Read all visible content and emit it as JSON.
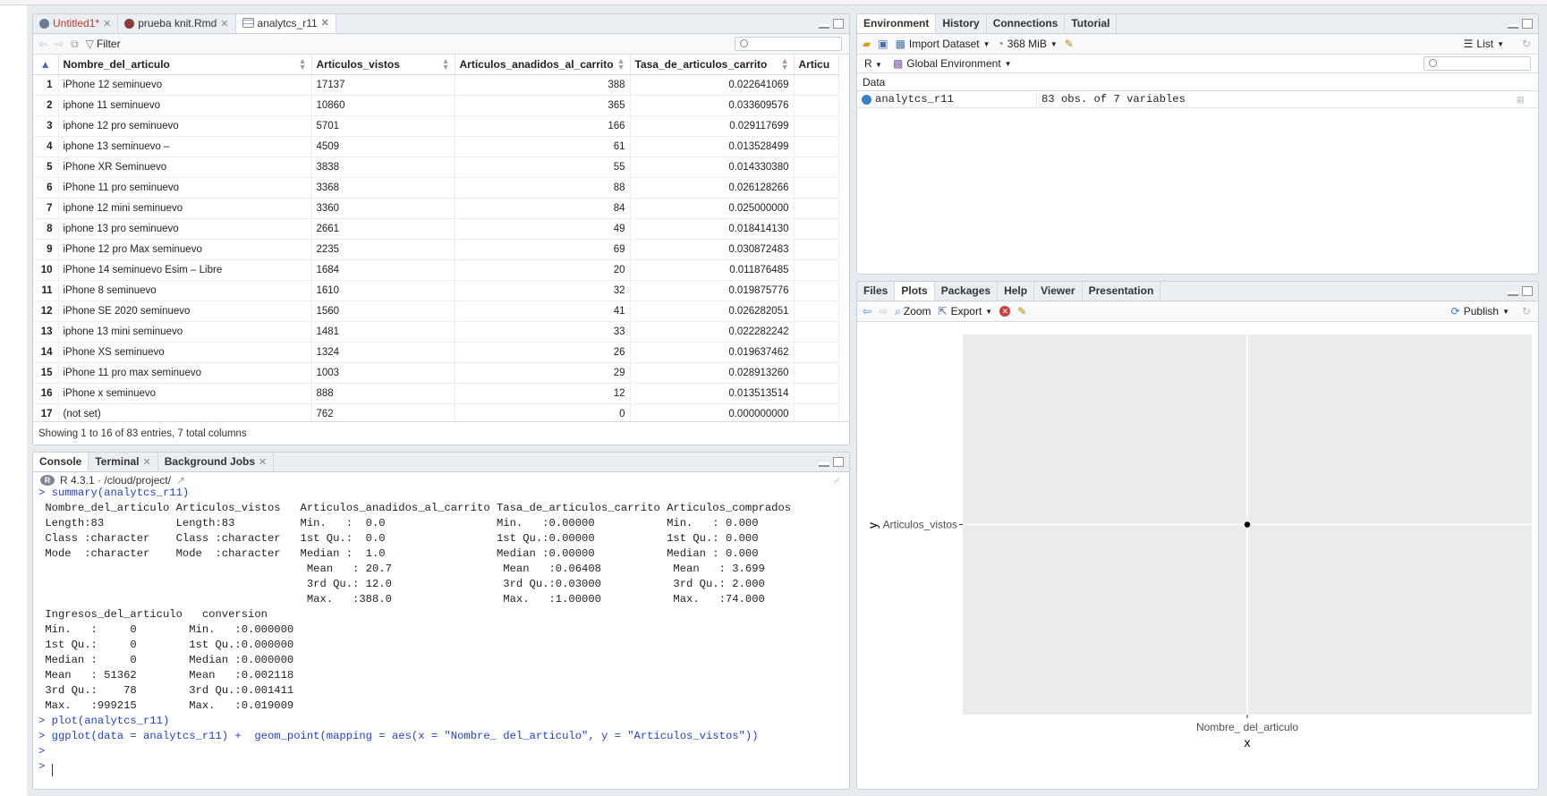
{
  "source_tabs": [
    {
      "label": "Untitled1*",
      "color": "#c0392b"
    },
    {
      "label": "prueba knit.Rmd"
    },
    {
      "label": "analytcs_r11",
      "active": true
    }
  ],
  "viewer": {
    "filter_label": "Filter",
    "columns": [
      "Nombre_del_articulo",
      "Articulos_vistos",
      "Articulos_anadidos_al_carrito",
      "Tasa_de_articulos_carrito",
      "Articu"
    ],
    "rows": [
      [
        "1",
        "iPhone 12 seminuevo",
        "17137",
        "388",
        "0.022641069"
      ],
      [
        "2",
        "iphone 11 seminuevo",
        "10860",
        "365",
        "0.033609576"
      ],
      [
        "3",
        "iphone 12 pro seminuevo",
        "5701",
        "166",
        "0.029117699"
      ],
      [
        "4",
        "iphone 13 seminuevo –",
        "4509",
        "61",
        "0.013528499"
      ],
      [
        "5",
        "iPhone XR Seminuevo",
        "3838",
        "55",
        "0.014330380"
      ],
      [
        "6",
        "iPhone 11 pro seminuevo",
        "3368",
        "88",
        "0.026128266"
      ],
      [
        "7",
        "iphone 12 mini seminuevo",
        "3360",
        "84",
        "0.025000000"
      ],
      [
        "8",
        "iphone 13 pro seminuevo",
        "2661",
        "49",
        "0.018414130"
      ],
      [
        "9",
        "iPhone 12 pro Max seminuevo",
        "2235",
        "69",
        "0.030872483"
      ],
      [
        "10",
        "iPhone 14 seminuevo Esim – Libre",
        "1684",
        "20",
        "0.011876485"
      ],
      [
        "11",
        "iPhone 8 seminuevo",
        "1610",
        "32",
        "0.019875776"
      ],
      [
        "12",
        "iPhone SE  2020 seminuevo",
        "1560",
        "41",
        "0.026282051"
      ],
      [
        "13",
        "iphone 13 mini seminuevo",
        "1481",
        "33",
        "0.022282242"
      ],
      [
        "14",
        "iPhone XS seminuevo",
        "1324",
        "26",
        "0.019637462"
      ],
      [
        "15",
        "iPhone 11 pro max seminuevo",
        "1003",
        "29",
        "0.028913260"
      ],
      [
        "16",
        "iPhone x seminuevo",
        "888",
        "12",
        "0.013513514"
      ],
      [
        "17",
        "(not set)",
        "762",
        "0",
        "0.000000000"
      ]
    ],
    "status": "Showing 1 to 16 of 83 entries, 7 total columns"
  },
  "console": {
    "tabs": [
      "Console",
      "Terminal",
      "Background Jobs"
    ],
    "path_label": "R 4.3.1 · /cloud/project/",
    "lines": [
      {
        "text": "> summary(analytcs_r11)",
        "color": "#1f3fd1"
      },
      {
        "text": " Nombre_del_articulo Articulos_vistos   Articulos_anadidos_al_carrito Tasa_de_articulos_carrito Articulos_comprados"
      },
      {
        "text": " Length:83           Length:83          Min.   :  0.0                 Min.   :0.00000           Min.   : 0.000"
      },
      {
        "text": " Class :character    Class :character   1st Qu.:  0.0                 1st Qu.:0.00000           1st Qu.: 0.000"
      },
      {
        "text": " Mode  :character    Mode  :character   Median :  1.0                 Median :0.00000           Median : 0.000"
      },
      {
        "text": "                                         Mean   : 20.7                 Mean   :0.06408           Mean   : 3.699"
      },
      {
        "text": "                                         3rd Qu.: 12.0                 3rd Qu.:0.03000           3rd Qu.: 2.000"
      },
      {
        "text": "                                         Max.   :388.0                 Max.   :1.00000           Max.   :74.000"
      },
      {
        "text": " Ingresos_del_articulo   conversion"
      },
      {
        "text": " Min.   :     0        Min.   :0.000000"
      },
      {
        "text": " 1st Qu.:     0        1st Qu.:0.000000"
      },
      {
        "text": " Median :     0        Median :0.000000"
      },
      {
        "text": " Mean   : 51362        Mean   :0.002118"
      },
      {
        "text": " 3rd Qu.:    78        3rd Qu.:0.001411"
      },
      {
        "text": " Max.   :999215        Max.   :0.019009"
      },
      {
        "text": "> plot(analytcs_r11)",
        "color": "#1f3fd1"
      },
      {
        "text": "> ggplot(data = analytcs_r11) +  geom_point(mapping = aes(x = \"Nombre_ del_articulo\", y = \"Articulos_vistos\"))",
        "color": "#1f3fd1"
      },
      {
        "text": ">",
        "color": "#1f3fd1"
      },
      {
        "text": ">",
        "color": "#1f3fd1"
      }
    ]
  },
  "environment": {
    "tabs": [
      "Environment",
      "History",
      "Connections",
      "Tutorial"
    ],
    "import_label": "Import Dataset",
    "memory_label": "368 MiB",
    "list_label": "List",
    "lang_label": "R",
    "scope_label": "Global Environment",
    "section": "Data",
    "rows": [
      {
        "name": "analytcs_r11",
        "value": "83 obs. of 7 variables"
      }
    ]
  },
  "files_pane": {
    "tabs": [
      "Files",
      "Plots",
      "Packages",
      "Help",
      "Viewer",
      "Presentation"
    ],
    "zoom_label": "Zoom",
    "export_label": "Export",
    "publish_label": "Publish"
  },
  "chart_data": {
    "type": "scatter",
    "categories": [
      "Nombre_ del_articulo"
    ],
    "series": [
      {
        "x": [
          "Nombre_ del_articulo"
        ],
        "y": [
          "Articulos_vistos"
        ]
      }
    ],
    "xlabel": "x",
    "ylabel": "y",
    "x_tick_labels": [
      "Nombre_ del_articulo"
    ],
    "y_tick_labels": [
      "Articulos_vistos"
    ],
    "grid": true,
    "panel_background": "#ebebeb"
  },
  "colors": {
    "accent": "#1f3fd1",
    "tab_active_text": "#c0392b"
  }
}
